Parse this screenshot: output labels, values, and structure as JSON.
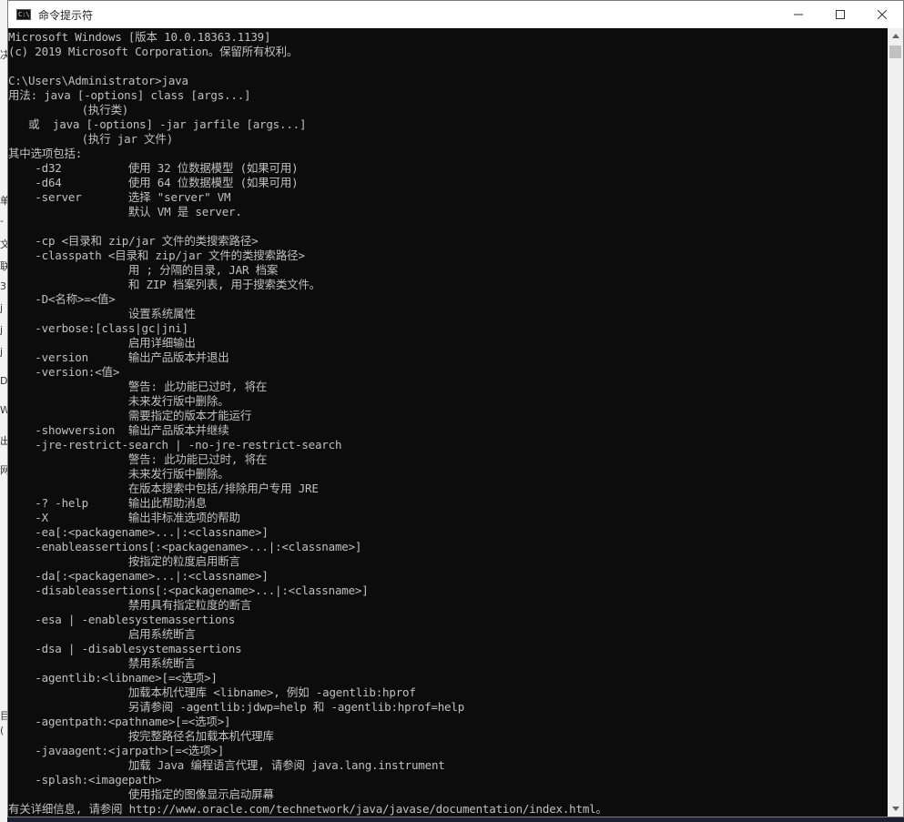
{
  "window": {
    "title": "命令提示符",
    "icon": "cmd-icon",
    "controls": {
      "minimize": "minimize-icon",
      "maximize": "maximize-icon",
      "close": "close-icon"
    }
  },
  "background_fragments": [
    "决",
    "单",
    "-",
    "文",
    "联",
    "3",
    "j",
    "j",
    "j",
    "D",
    "W",
    "出",
    "网",
    "目",
    "("
  ],
  "console": {
    "lines": [
      "Microsoft Windows [版本 10.0.18363.1139]",
      "(c) 2019 Microsoft Corporation。保留所有权利。",
      "",
      "C:\\Users\\Administrator>java",
      "用法: java [-options] class [args...]",
      "           (执行类)",
      "   或  java [-options] -jar jarfile [args...]",
      "           (执行 jar 文件)",
      "其中选项包括:",
      "    -d32          使用 32 位数据模型 (如果可用)",
      "    -d64          使用 64 位数据模型 (如果可用)",
      "    -server       选择 \"server\" VM",
      "                  默认 VM 是 server.",
      "",
      "    -cp <目录和 zip/jar 文件的类搜索路径>",
      "    -classpath <目录和 zip/jar 文件的类搜索路径>",
      "                  用 ; 分隔的目录, JAR 档案",
      "                  和 ZIP 档案列表, 用于搜索类文件。",
      "    -D<名称>=<值>",
      "                  设置系统属性",
      "    -verbose:[class|gc|jni]",
      "                  启用详细输出",
      "    -version      输出产品版本并退出",
      "    -version:<值>",
      "                  警告: 此功能已过时, 将在",
      "                  未来发行版中删除。",
      "                  需要指定的版本才能运行",
      "    -showversion  输出产品版本并继续",
      "    -jre-restrict-search | -no-jre-restrict-search",
      "                  警告: 此功能已过时, 将在",
      "                  未来发行版中删除。",
      "                  在版本搜索中包括/排除用户专用 JRE",
      "    -? -help      输出此帮助消息",
      "    -X            输出非标准选项的帮助",
      "    -ea[:<packagename>...|:<classname>]",
      "    -enableassertions[:<packagename>...|:<classname>]",
      "                  按指定的粒度启用断言",
      "    -da[:<packagename>...|:<classname>]",
      "    -disableassertions[:<packagename>...|:<classname>]",
      "                  禁用具有指定粒度的断言",
      "    -esa | -enablesystemassertions",
      "                  启用系统断言",
      "    -dsa | -disablesystemassertions",
      "                  禁用系统断言",
      "    -agentlib:<libname>[=<选项>]",
      "                  加载本机代理库 <libname>, 例如 -agentlib:hprof",
      "                  另请参阅 -agentlib:jdwp=help 和 -agentlib:hprof=help",
      "    -agentpath:<pathname>[=<选项>]",
      "                  按完整路径名加载本机代理库",
      "    -javaagent:<jarpath>[=<选项>]",
      "                  加载 Java 编程语言代理, 请参阅 java.lang.instrument",
      "    -splash:<imagepath>",
      "                  使用指定的图像显示启动屏幕",
      "有关详细信息, 请参阅 http://www.oracle.com/technetwork/java/javase/documentation/index.html。"
    ]
  },
  "colors": {
    "console_bg": "#0c0c0c",
    "console_fg": "#c0c0c0",
    "titlebar_bg": "#ffffff"
  }
}
